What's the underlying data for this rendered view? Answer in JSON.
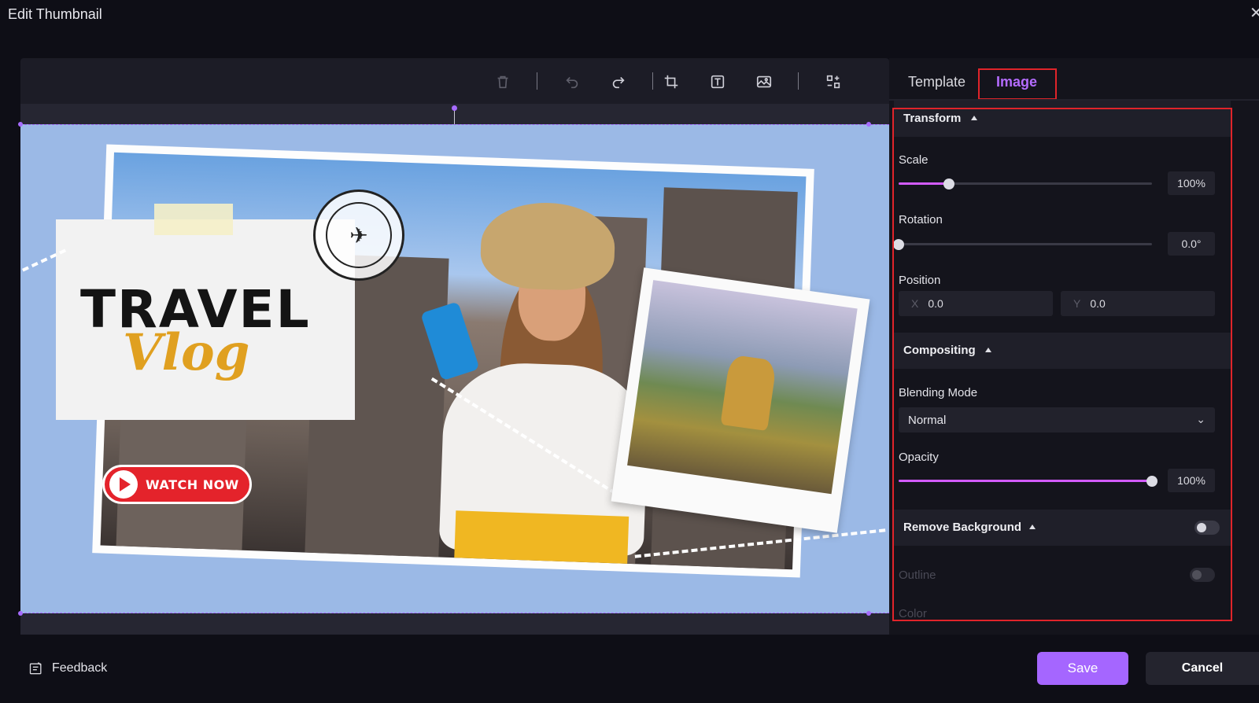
{
  "window": {
    "title": "Edit Thumbnail",
    "close_glyph": "✕"
  },
  "toolbar": {
    "icons": [
      "trash-icon",
      "undo-icon",
      "redo-icon",
      "crop-icon",
      "text-icon",
      "image-icon",
      "replace-icon"
    ]
  },
  "thumbnail": {
    "headline": "TRAVEL",
    "script": "Vlog",
    "button_label": "WATCH NOW",
    "stamp_glyph": "✈"
  },
  "panel": {
    "tabs": [
      {
        "label": "Template",
        "active": false
      },
      {
        "label": "Image",
        "active": true
      }
    ],
    "transform": {
      "title": "Transform",
      "scale_label": "Scale",
      "scale_value": "100%",
      "scale_fraction": 0.2,
      "rotation_label": "Rotation",
      "rotation_value": "0.0°",
      "rotation_fraction": 0.0,
      "position_label": "Position",
      "x_axis": "X",
      "x_value": "0.0",
      "y_axis": "Y",
      "y_value": "0.0"
    },
    "compositing": {
      "title": "Compositing",
      "blend_label": "Blending Mode",
      "blend_value": "Normal",
      "opacity_label": "Opacity",
      "opacity_value": "100%",
      "opacity_fraction": 1.0
    },
    "remove_background": {
      "title": "Remove Background",
      "enabled": false,
      "outline_label": "Outline",
      "outline_enabled": false,
      "color_label": "Color"
    }
  },
  "footer": {
    "feedback_label": "Feedback",
    "save_label": "Save",
    "cancel_label": "Cancel"
  },
  "colors": {
    "accent": "#a566ff",
    "slider_fill": "#d35bff",
    "highlight": "#e0242a",
    "canvas_bg": "#9bb9e6"
  }
}
